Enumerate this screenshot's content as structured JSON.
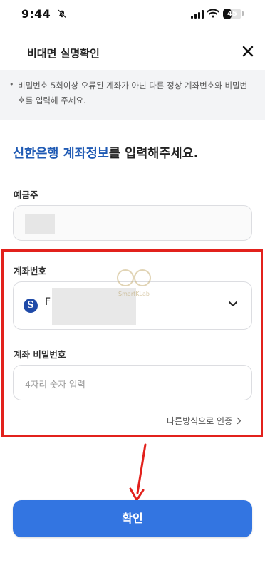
{
  "status_bar": {
    "time": "9:44",
    "battery": "45",
    "battery_level": 0.45
  },
  "header": {
    "title": "비대면 실명확인"
  },
  "notice": {
    "bullet": "•",
    "text": "비밀번호 5회이상 오류된 계좌가 아닌 다른 정상 계좌번호와 비밀번호를 입력해 주세요."
  },
  "instruction": {
    "highlight": "신한은행 계좌정보",
    "rest": "를 입력해주세요."
  },
  "depositor": {
    "label": "예금주"
  },
  "account": {
    "label": "계좌번호",
    "prefix": "F",
    "bank_logo": "S"
  },
  "password": {
    "label": "계좌 비밀번호",
    "placeholder": "4자리 숫자 입력"
  },
  "alt_method": {
    "label": "다른방식으로 인증"
  },
  "confirm": {
    "label": "확인"
  },
  "watermark": {
    "text": "SmartKLab"
  },
  "colors": {
    "accent": "#3375e1",
    "highlight_text": "#1f5ab4",
    "annotation": "#e2211c"
  },
  "icons": [
    "bell-off-icon",
    "signal-icon",
    "wifi-icon",
    "battery-icon",
    "close-icon",
    "bank-logo-icon",
    "chevron-down-icon",
    "chevron-right-icon",
    "arrow-down-icon"
  ]
}
